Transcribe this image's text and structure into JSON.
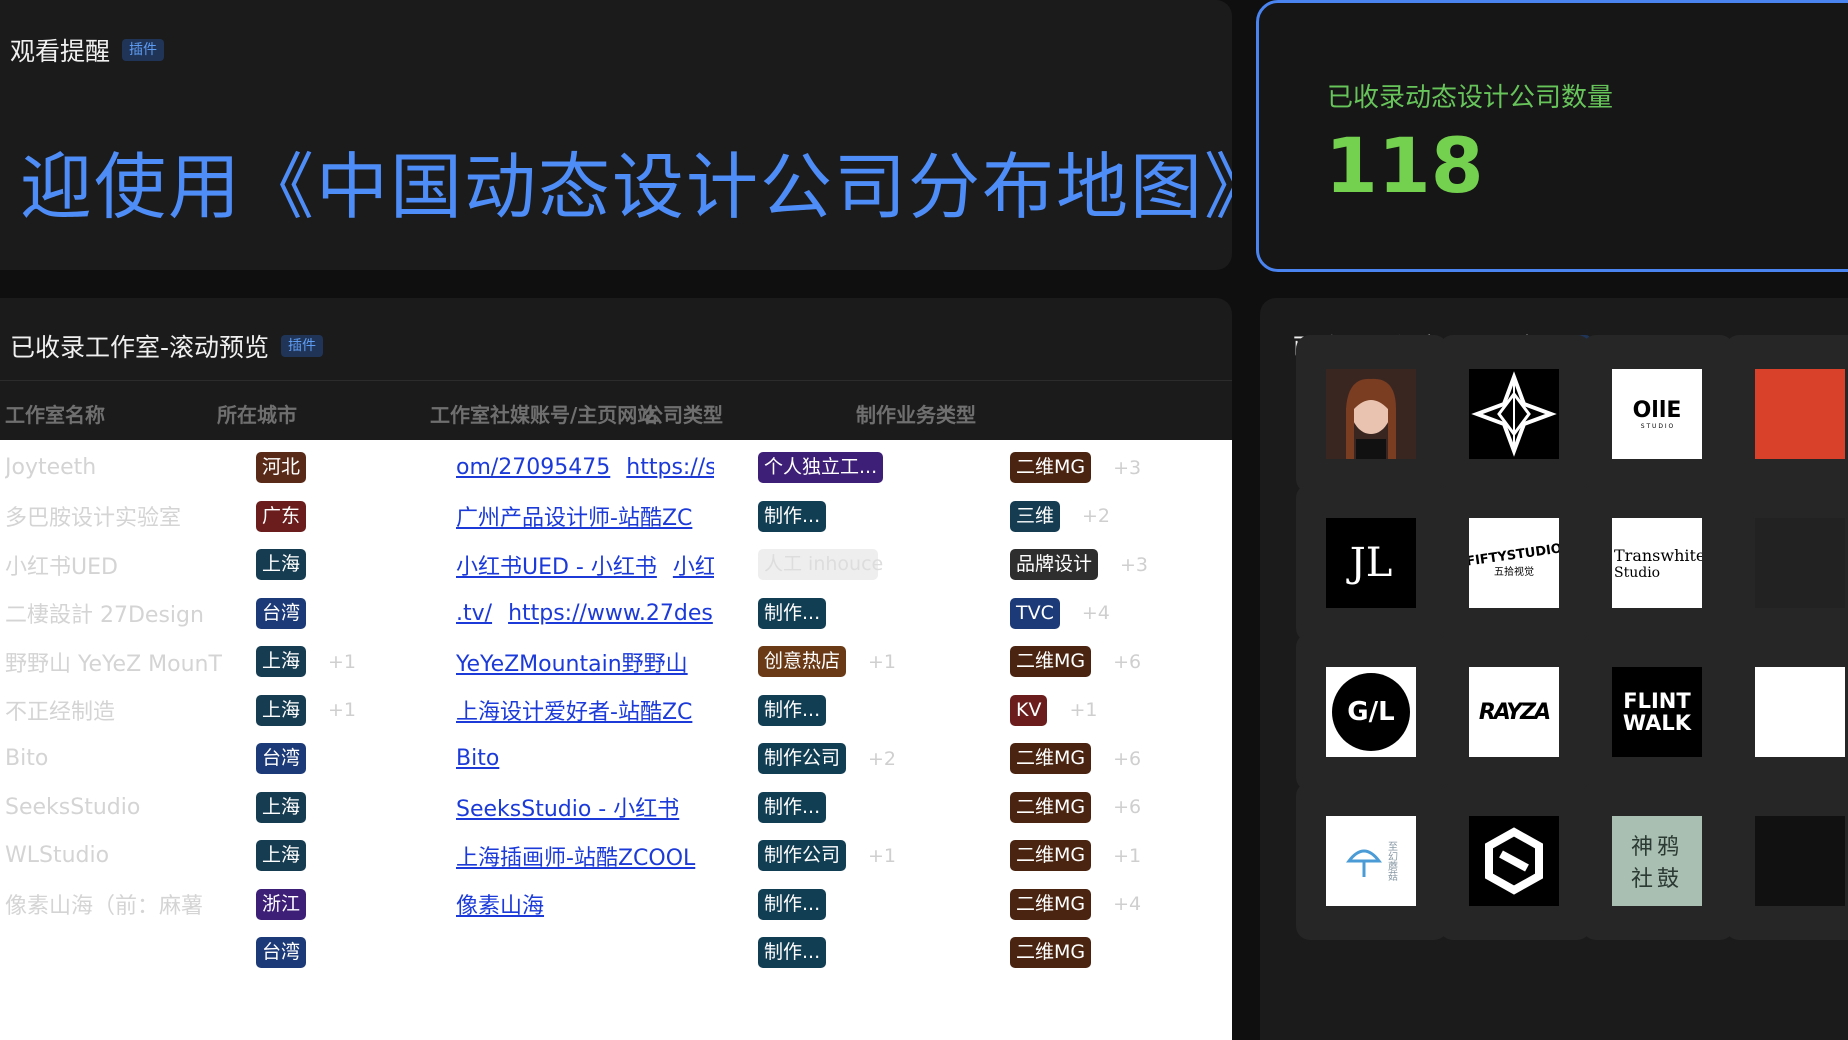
{
  "reminder": {
    "title": "观看提醒",
    "badge": "插件",
    "marquee": "迎使用《中国动态设计公司分布地图》，"
  },
  "count": {
    "label": "已收录动态设计公司数量",
    "value": "118"
  },
  "table": {
    "title": "已收录工作室-滚动预览",
    "badge": "插件",
    "columns": [
      "工作室名称",
      "所在城市",
      "工作室社媒账号/主页网站",
      "公司类型",
      "制作业务类型"
    ],
    "rows": [
      {
        "name": "Joyteeth",
        "city": "河北",
        "city_more": "",
        "links": [
          "om/27095475",
          "https://s"
        ],
        "ctype": "个人独立工...",
        "ctype_more": "",
        "btype": "二维MG",
        "btype_more": "+3"
      },
      {
        "name": "多巴胺设计实验室",
        "city": "广东",
        "city_more": "",
        "links": [
          "广州产品设计师-站酷ZC"
        ],
        "ctype": "制作...",
        "ctype_more": "",
        "btype": "三维",
        "btype_more": "+2"
      },
      {
        "name": "小红书UED",
        "city": "上海",
        "city_more": "",
        "links": [
          "小红书UED - 小红书",
          "小红"
        ],
        "ctype": "人工 inhouce",
        "ctype_more": "",
        "btype": "品牌设计",
        "btype_more": "+3"
      },
      {
        "name": "二棲設計 27Design",
        "city": "台湾",
        "city_more": "",
        "links": [
          ".tv/",
          "https://www.27des"
        ],
        "ctype": "制作...",
        "ctype_more": "",
        "btype": "TVC",
        "btype_more": "+4"
      },
      {
        "name": "野野山 YeYeZ MounT",
        "city": "上海",
        "city_more": "+1",
        "links": [
          "YeYeZMountain野野山"
        ],
        "ctype": "创意热店",
        "ctype_more": "+1",
        "btype": "二维MG",
        "btype_more": "+6"
      },
      {
        "name": "不正经制造",
        "city": "上海",
        "city_more": "+1",
        "links": [
          "上海设计爱好者-站酷ZC"
        ],
        "ctype": "制作...",
        "ctype_more": "",
        "btype": "KV",
        "btype_more": "+1"
      },
      {
        "name": "Bito",
        "city": "台湾",
        "city_more": "",
        "links": [
          "Bito"
        ],
        "ctype": "制作公司",
        "ctype_more": "+2",
        "btype": "二维MG",
        "btype_more": "+6"
      },
      {
        "name": "SeeksStudio",
        "city": "上海",
        "city_more": "",
        "links": [
          "SeeksStudio - 小红书"
        ],
        "ctype": "制作...",
        "ctype_more": "",
        "btype": "二维MG",
        "btype_more": "+6"
      },
      {
        "name": "WLStudio",
        "city": "上海",
        "city_more": "",
        "links": [
          "上海插画师-站酷ZCOOL"
        ],
        "ctype": "制作公司",
        "ctype_more": "+1",
        "btype": "二维MG",
        "btype_more": "+1"
      },
      {
        "name": "像素山海（前：麻薯",
        "city": "浙江",
        "city_more": "",
        "links": [
          "像素山海"
        ],
        "ctype": "制作...",
        "ctype_more": "",
        "btype": "二维MG",
        "btype_more": "+4"
      },
      {
        "name": "",
        "city": "台湾",
        "city_more": "",
        "links": [
          ""
        ],
        "ctype": "制作...",
        "ctype_more": "",
        "btype": "二维MG",
        "btype_more": ""
      }
    ]
  },
  "logo_wall": {
    "title": "已收录工作室-Logo墙",
    "badge": "插件",
    "logos": [
      "portrait",
      "star-emblem",
      "OLLIE",
      "red-partial",
      "JL",
      "FIFTYSTUDIO",
      "Transwhite Studio",
      "dark-partial",
      "G/L",
      "brush-wordmark",
      "FLINT WALK",
      "white-partial",
      "mushroom",
      "hex-knot",
      "神鸦社鼓",
      "dark-partial-2"
    ],
    "logo_texts": {
      "ollie": "OllE",
      "ollie_sub": "S T U D I O",
      "jl": "JL",
      "fifty": "FIFTYSTUDIO",
      "fifty_sub": "五拾视觉",
      "trans1": "Transwhite",
      "trans2": "Studio",
      "gl": "G/L",
      "brush": "RAYZA",
      "flint1": "FLINT",
      "flint2": "WALK",
      "mush": "至幻蘑菇",
      "crow1": "神鸦",
      "crow2": "社鼓"
    }
  },
  "colors": {
    "accent_blue": "#4e8df7",
    "count_green": "#74d04f",
    "tag_province_brown": "#5a2a18",
    "tag_province_red": "#6b1d1d",
    "tag_city_teal": "#163c52",
    "tag_city_navy": "#1c3a78",
    "tag_purple": "#3e1f78",
    "tag_type_teal": "#123e54",
    "tag_type_brown": "#6a3a16",
    "tag_bizmg_brown": "#4a2410"
  }
}
